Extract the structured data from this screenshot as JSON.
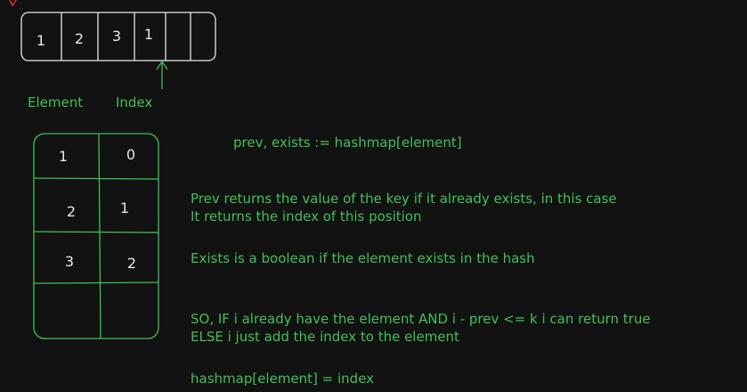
{
  "colors": {
    "background": "#121212",
    "white_stroke": "#e8e8e8",
    "green_stroke": "#40c057"
  },
  "array": {
    "cells": [
      "1",
      "2",
      "3",
      "1",
      "",
      ""
    ]
  },
  "labels": {
    "element": "Element",
    "index": "Index"
  },
  "hash_table": {
    "rows": [
      {
        "key": "1",
        "value": "0"
      },
      {
        "key": "2",
        "value": "1"
      },
      {
        "key": "3",
        "value": "2"
      },
      {
        "key": "",
        "value": ""
      }
    ]
  },
  "notes": {
    "code_line": "prev, exists := hashmap[element]",
    "prev_line1": "Prev returns the value of the key if it already exists, in this case",
    "prev_line2": "It returns the index of this position",
    "exists_line": "Exists is a boolean if the element exists in the hash",
    "so_line1": "SO, IF i already have the element AND i - prev <= k i can return true",
    "so_line2": "ELSE i just add the index to the element",
    "assign_line": "hashmap[element] = index"
  }
}
